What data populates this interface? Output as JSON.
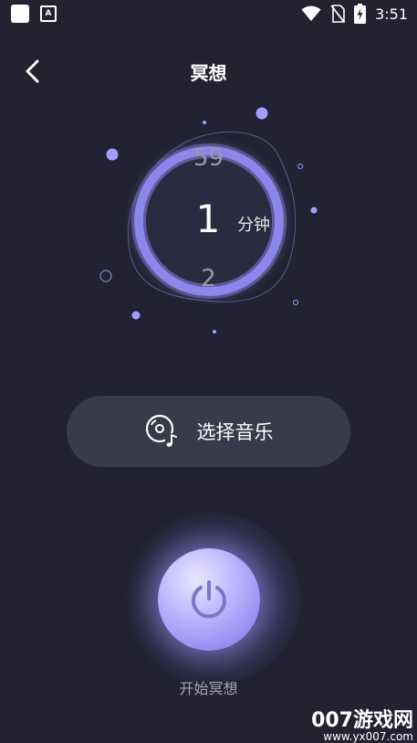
{
  "status_bar": {
    "time": "3:51",
    "left_icons": [
      "app-square-icon",
      "font-a-icon"
    ],
    "right_icons": [
      "wifi-icon",
      "no-sim-icon",
      "battery-charging-icon"
    ]
  },
  "header": {
    "back_icon": "chevron-left-icon",
    "title": "冥想"
  },
  "timer": {
    "prev_value": "59",
    "current_value": "1",
    "next_value": "2",
    "unit": "分钟",
    "accent_color": "#8c86ea"
  },
  "music": {
    "icon": "music-disc-icon",
    "label": "选择音乐"
  },
  "start": {
    "icon": "power-icon",
    "label": "开始冥想"
  },
  "watermark": {
    "main": "007游戏网",
    "sub": "www.yx007.com"
  }
}
